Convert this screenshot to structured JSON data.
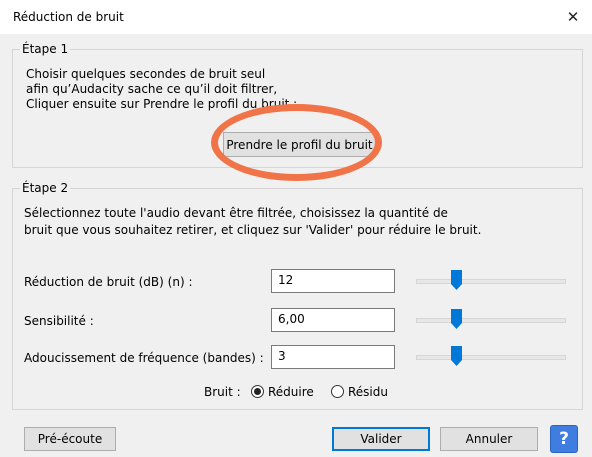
{
  "window": {
    "title": "Réduction de bruit",
    "close_glyph": "✕"
  },
  "step1": {
    "legend": "Étape 1",
    "lines": [
      "Choisir quelques secondes de bruit seul",
      "afin qu’Audacity sache ce qu’il doit filtrer,",
      "Cliquer ensuite sur Prendre le profil du bruit :"
    ],
    "button_label": "Prendre le profil du bruit"
  },
  "step2": {
    "legend": "Étape 2",
    "lines": [
      "Sélectionnez toute l'audio devant être filtrée, choisissez la quantité de",
      "bruit que vous souhaitez retirer, et cliquez sur 'Valider' pour réduire le bruit."
    ],
    "controls": [
      {
        "label": "Réduction de bruit (dB) (n) :",
        "value": "12",
        "slider_level": 0.27
      },
      {
        "label": "Sensibilité :",
        "value": "6,00",
        "slider_level": 0.27
      },
      {
        "label": "Adoucissement de fréquence (bandes) :",
        "value": "3",
        "slider_level": 0.27
      }
    ],
    "noise": {
      "label": "Bruit :",
      "options": [
        {
          "label": "Réduire",
          "selected": true
        },
        {
          "label": "Résidu",
          "selected": false
        }
      ]
    }
  },
  "footer": {
    "preview_label": "Pré-écoute",
    "ok_label": "Valider",
    "cancel_label": "Annuler",
    "help_glyph": "?"
  },
  "colors": {
    "accent": "#0078d7",
    "annotation": "#f07448",
    "help_button": "#3f7ee0",
    "dialog_bg": "#f0f0f0"
  }
}
